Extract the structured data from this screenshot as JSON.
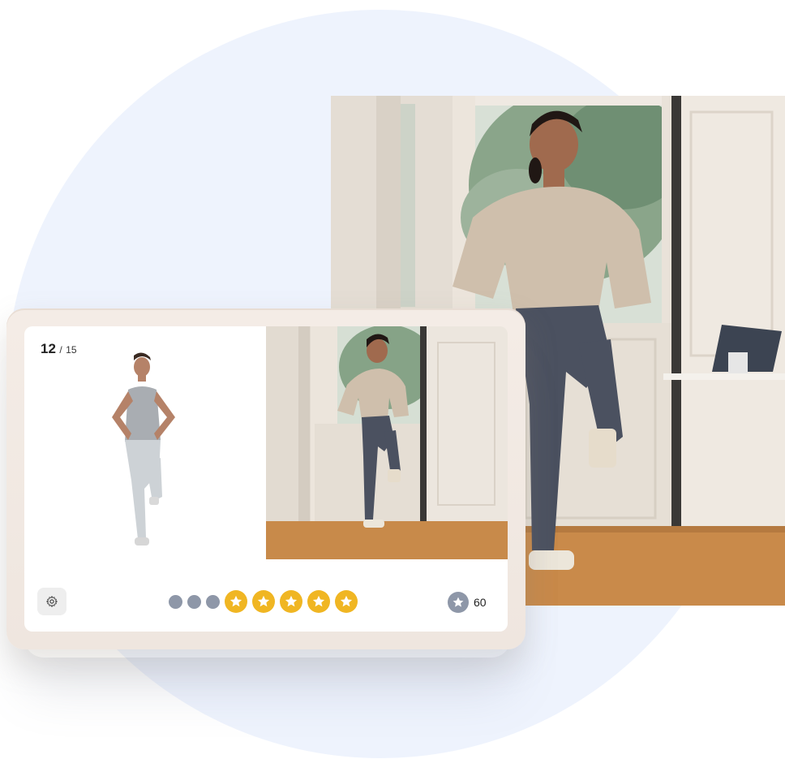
{
  "exercise": {
    "current": "12",
    "separator": "/",
    "total": "15"
  },
  "progress": {
    "completed_dots": 3,
    "stars": 5
  },
  "score": {
    "value": "60"
  },
  "icons": {
    "settings": "gear-icon",
    "star": "star-icon"
  },
  "colors": {
    "star_gold": "#f0b623",
    "dot_gray": "#8e97a8",
    "background_circle": "#eef3fd"
  }
}
